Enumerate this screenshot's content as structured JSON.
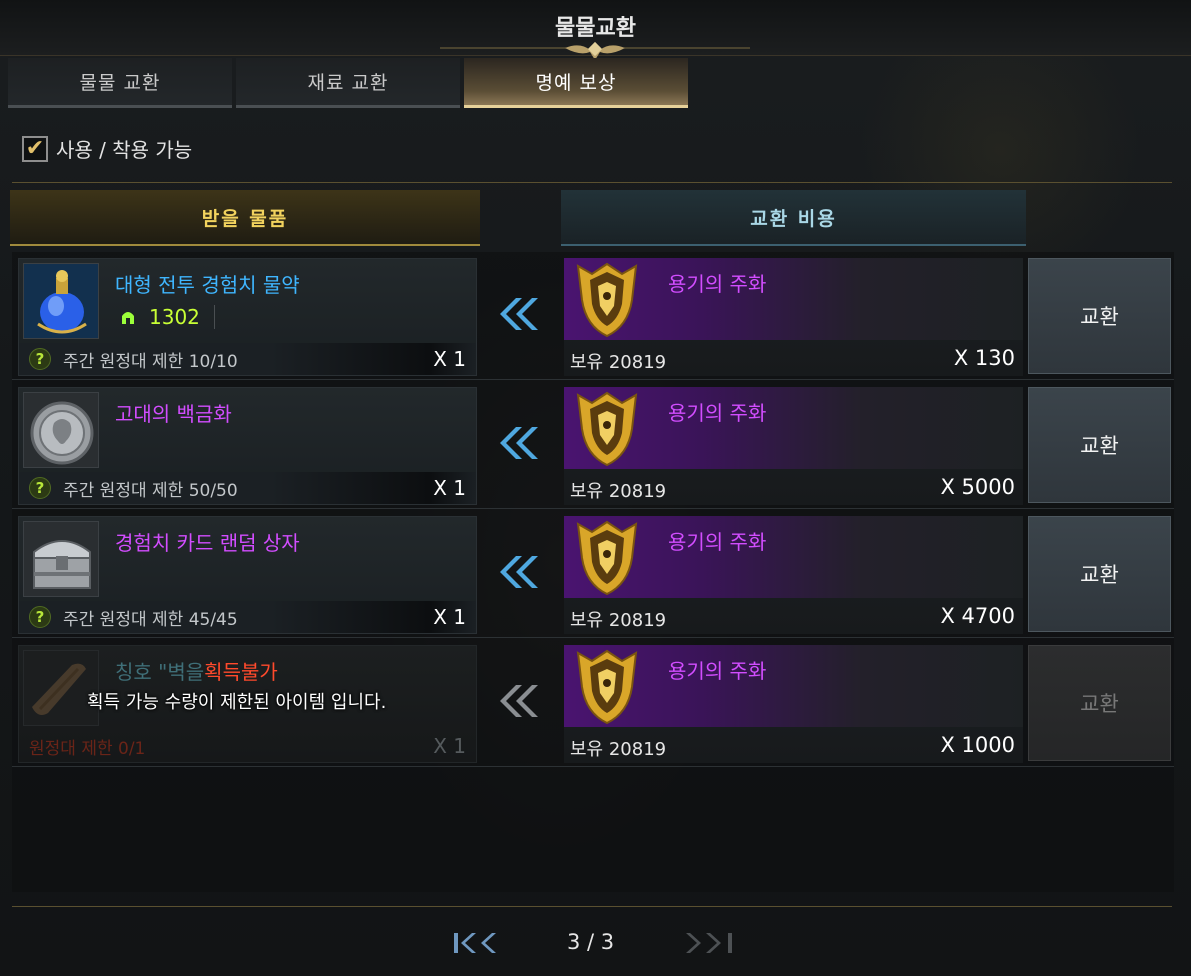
{
  "window": {
    "title": "물물교환"
  },
  "tabs": [
    {
      "label": "물물 교환",
      "active": false
    },
    {
      "label": "재료 교환",
      "active": false
    },
    {
      "label": "명예 보상",
      "active": true
    }
  ],
  "filter": {
    "label": "사용 / 착용 가능",
    "checked": true
  },
  "columns": {
    "receive": "받을 물품",
    "cost": "교환 비용"
  },
  "rows": [
    {
      "item_name": "대형 전투 경험치 물약",
      "item_level": "1302",
      "limit": "주간 원정대 제한 10/10",
      "item_qty": "X 1",
      "cost_name": "용기의 주화",
      "owned": "보유 20819",
      "cost_qty": "X 130",
      "button": "교환"
    },
    {
      "item_name": "고대의 백금화",
      "limit": "주간 원정대 제한 50/50",
      "item_qty": "X 1",
      "cost_name": "용기의 주화",
      "owned": "보유 20819",
      "cost_qty": "X 5000",
      "button": "교환"
    },
    {
      "item_name": "경험치 카드 랜덤 상자",
      "limit": "주간 원정대 제한 45/45",
      "item_qty": "X 1",
      "cost_name": "용기의 주화",
      "owned": "보유 20819",
      "cost_qty": "X 4700",
      "button": "교환"
    },
    {
      "item_name_dim": "칭호 \"벽을",
      "item_name_warn": "획득불가",
      "tooltip": "획득 가능 수량이 제한된 아이템 입니다.",
      "limit": "원정대 제한 0/1",
      "item_qty": "X 1",
      "cost_name": "용기의 주화",
      "owned": "보유 20819",
      "cost_qty": "X 1000",
      "button": "교환"
    }
  ],
  "pager": {
    "text": "3 / 3"
  }
}
